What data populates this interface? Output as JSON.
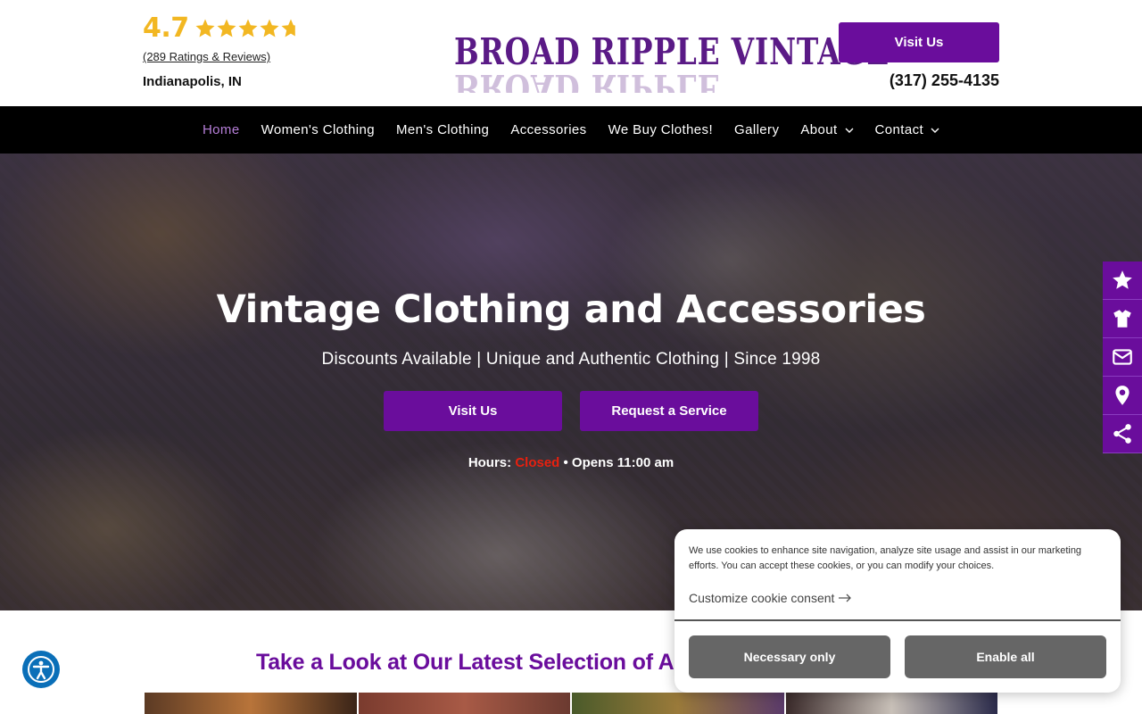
{
  "header": {
    "rating_score": "4.7",
    "rating_value": 4.7,
    "rating_max": 5,
    "reviews_link": "(289 Ratings & Reviews)",
    "location": "Indianapolis, IN",
    "logo_text": "BROAD RIPPLE VINTAGE",
    "visit_button": "Visit Us",
    "phone": "(317) 255-4135"
  },
  "nav": {
    "items": [
      {
        "label": "Home",
        "active": true
      },
      {
        "label": "Women's Clothing"
      },
      {
        "label": "Men's Clothing"
      },
      {
        "label": "Accessories"
      },
      {
        "label": "We Buy Clothes!"
      },
      {
        "label": "Gallery"
      },
      {
        "label": "About",
        "dropdown": true
      },
      {
        "label": "Contact",
        "dropdown": true
      }
    ]
  },
  "hero": {
    "title": "Vintage Clothing and Accessories",
    "subtitle": "Discounts Available | Unique and Authentic Clothing | Since 1998",
    "visit_button": "Visit Us",
    "request_button": "Request a Service",
    "hours_label": "Hours:",
    "hours_status": "Closed",
    "hours_next": "• Opens 11:00 am"
  },
  "side_toolbar": {
    "icons": [
      "star-icon",
      "shirt-icon",
      "envelope-icon",
      "map-pin-icon",
      "share-icon"
    ]
  },
  "section": {
    "title": "Take a Look at Our Latest Selection of Apparel"
  },
  "cookie": {
    "text": "We use cookies to enhance site navigation, analyze site usage and assist in our marketing efforts. You can accept these cookies, or you can modify your choices.",
    "customize_link": "Customize cookie consent",
    "necessary_button": "Necessary only",
    "enable_button": "Enable all"
  },
  "colors": {
    "brand_purple": "#6a0d9c",
    "star_gold": "#f2b722",
    "nav_active": "#b67fd8",
    "closed_red": "#e8200f",
    "accessibility_blue": "#0a6fb8"
  }
}
